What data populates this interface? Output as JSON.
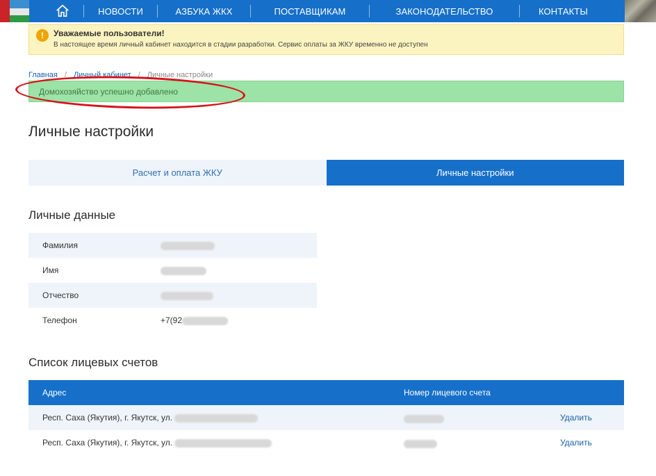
{
  "nav": {
    "items": [
      "Новости",
      "Азбука ЖКХ",
      "Поставщикам",
      "Законодательство",
      "Контакты"
    ],
    "home_icon": "home-icon"
  },
  "warning": {
    "title": "Уважаемые пользователи!",
    "text": "В настоящее время личный кабинет находится в стадии разработки. Сервис оплаты за ЖКУ временно не доступен",
    "icon": "exclamation-icon",
    "icon_glyph": "!"
  },
  "breadcrumb": {
    "home": "Главная",
    "separator": "/",
    "middle": "Личный кабинет",
    "current": "Личные настройки"
  },
  "success": {
    "text": "Домохозяйство успешно добавлено"
  },
  "page_title": "Личные настройки",
  "tabs": {
    "payment": "Расчет и оплата ЖКУ",
    "settings": "Личные настройки"
  },
  "personal": {
    "title": "Личные данные",
    "rows": [
      {
        "label": "Фамилия"
      },
      {
        "label": "Имя"
      },
      {
        "label": "Отчество"
      },
      {
        "label": "Телефон",
        "value_prefix": "+7(92"
      }
    ]
  },
  "accounts": {
    "title": "Список лицевых счетов",
    "headers": {
      "address": "Адрес",
      "account": "Номер лицевого счета"
    },
    "rows": [
      {
        "address": "Респ. Саха (Якутия), г. Якутск, ул.",
        "delete": "Удалить"
      },
      {
        "address": "Респ. Саха (Якутия), г. Якутск, ул.",
        "delete": "Удалить"
      }
    ]
  },
  "colors": {
    "primary": "#1670c9",
    "warning_bg": "#fcf4c0",
    "success_bg": "#9de2a6",
    "annotation": "#d5141a"
  }
}
